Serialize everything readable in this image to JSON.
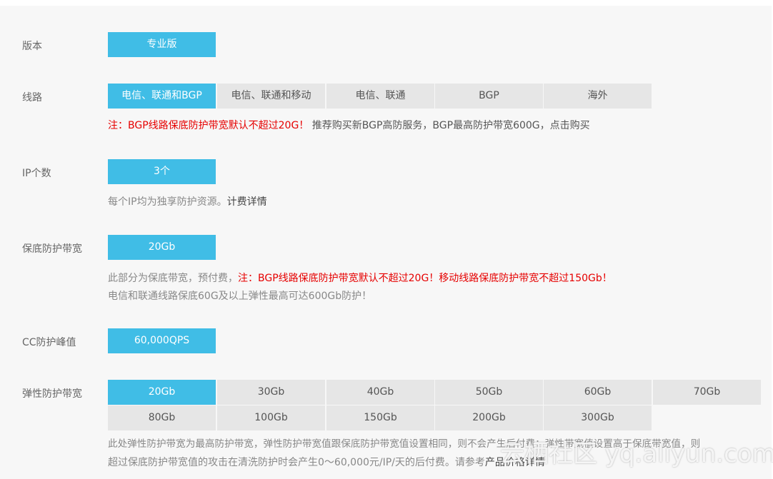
{
  "edition": {
    "label": "版本",
    "option": "专业版"
  },
  "route": {
    "label": "线路",
    "options": [
      "电信、联通和BGP",
      "电信、联通和移动",
      "电信、联通",
      "BGP",
      "海外"
    ],
    "selected": "电信、联通和BGP",
    "note_red": "注：BGP线路保底防护带宽默认不超过20G！",
    "note_rest": "推荐购买新BGP高防服务，BGP最高防护带宽600G，点击购买"
  },
  "ip_count": {
    "label": "IP个数",
    "option": "3个",
    "note": "每个IP均为独享防护资源。",
    "note_link": "计费详情"
  },
  "base_bandwidth": {
    "label": "保底防护带宽",
    "option": "20Gb",
    "note_line1_grey": "此部分为保底带宽，预付费，",
    "note_line1_red": "注：BGP线路保底防护带宽默认不超过20G！移动线路保底防护带宽不超过150Gb！",
    "note_line2": "电信和联通线路保底60G及以上弹性最高可达600Gb防护！"
  },
  "cc_peak": {
    "label": "CC防护峰值",
    "option": "60,000QPS"
  },
  "elastic_bandwidth": {
    "label": "弹性防护带宽",
    "options": [
      "20Gb",
      "30Gb",
      "40Gb",
      "50Gb",
      "60Gb",
      "70Gb",
      "80Gb",
      "100Gb",
      "150Gb",
      "200Gb",
      "300Gb"
    ],
    "selected": "20Gb",
    "note_line1": "此处弹性防护带宽为最高防护带宽，弹性防护带宽值跟保底防护带宽值设置相同，则不会产生后付费；弹性带宽值设置高于保底带宽值，则",
    "note_line2": "超过保底防护带宽值的攻击在清洗防护时会产生0～60,000元/IP/天的后付费。请参考",
    "note_link": "产品价格详情"
  },
  "watermark": "云栖社区 yq.aliyun.com",
  "colors": {
    "active": "#40bde6",
    "inactive": "#e6e6e6",
    "warning": "#e60000"
  }
}
